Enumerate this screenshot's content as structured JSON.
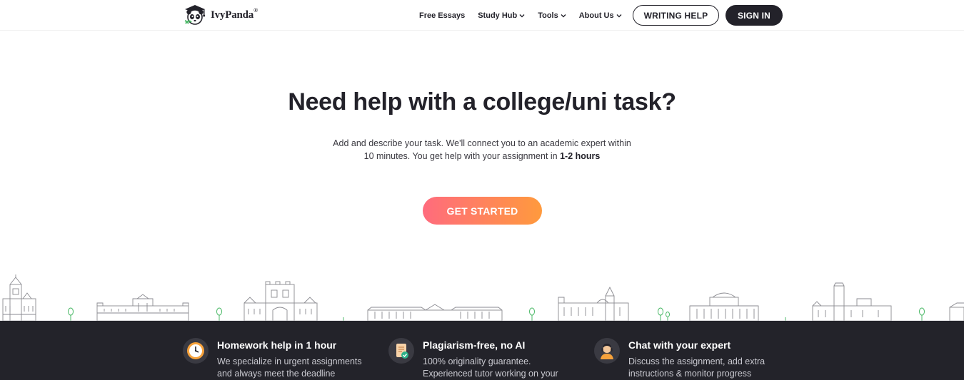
{
  "header": {
    "logo_text": "IvyPanda",
    "logo_reg": "®",
    "nav": [
      {
        "label": "Free Essays",
        "dropdown": false
      },
      {
        "label": "Study Hub",
        "dropdown": true
      },
      {
        "label": "Tools",
        "dropdown": true
      },
      {
        "label": "About Us",
        "dropdown": true
      }
    ],
    "writing_help_label": "WRITING HELP",
    "sign_in_label": "SIGN IN"
  },
  "hero": {
    "title": "Need help with a college/uni task?",
    "subtitle_line1": "Add and describe your task. We'll connect you to an academic expert within",
    "subtitle_line2_prefix": "10 minutes. You get help with your assignment in ",
    "subtitle_line2_bold": "1-2 hours",
    "cta_label": "GET STARTED"
  },
  "features": [
    {
      "title": "Homework help in 1 hour",
      "desc": "We specialize in urgent assignments and always meet the deadline",
      "icon": "clock-icon"
    },
    {
      "title": "Plagiarism-free, no AI",
      "desc": "100% originality guarantee. Experienced tutor working on your",
      "icon": "document-check-icon"
    },
    {
      "title": "Chat with your expert",
      "desc": "Discuss the assignment, add extra instructions & monitor progress",
      "icon": "expert-avatar-icon"
    }
  ],
  "colors": {
    "text_dark": "#23222a",
    "band_bg": "#23232a",
    "cta_gradient_start": "#ff6b7d",
    "cta_gradient_end": "#ff9a3d",
    "tree_green": "#4cb968"
  }
}
